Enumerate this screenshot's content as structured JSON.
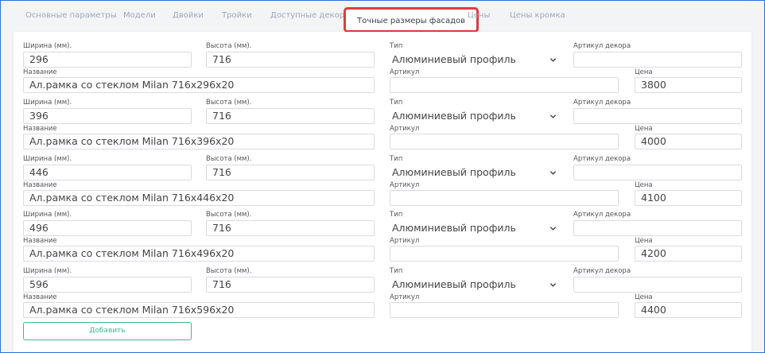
{
  "tabs": [
    {
      "label": "Основные параметры",
      "active": false
    },
    {
      "label": "Модели",
      "active": false
    },
    {
      "label": "Двойки",
      "active": false
    },
    {
      "label": "Тройки",
      "active": false
    },
    {
      "label": "Доступные декоры",
      "active": false
    },
    {
      "label": "Точные размеры фасадов",
      "active": true
    },
    {
      "label": "Цены",
      "active": false
    },
    {
      "label": "Цены кромка",
      "active": false
    }
  ],
  "labels": {
    "width": "Ширина (мм).",
    "height": "Высота (мм).",
    "type": "Тип",
    "decor_article": "Артикул декора",
    "name": "Название",
    "article": "Артикул",
    "price": "Цена"
  },
  "rows": [
    {
      "width": "296",
      "height": "716",
      "type": "Алюминиевый профиль",
      "decor_article": "",
      "name": "Ал.рамка со стеклом Milan 716x296x20",
      "article": "",
      "price": "3800"
    },
    {
      "width": "396",
      "height": "716",
      "type": "Алюминиевый профиль",
      "decor_article": "",
      "name": "Ал.рамка со стеклом Milan 716x396x20",
      "article": "",
      "price": "4000"
    },
    {
      "width": "446",
      "height": "716",
      "type": "Алюминиевый профиль",
      "decor_article": "",
      "name": "Ал.рамка со стеклом Milan 716x446x20",
      "article": "",
      "price": "4100"
    },
    {
      "width": "496",
      "height": "716",
      "type": "Алюминиевый профиль",
      "decor_article": "",
      "name": "Ал.рамка со стеклом Milan 716x496x20",
      "article": "",
      "price": "4200"
    },
    {
      "width": "596",
      "height": "716",
      "type": "Алюминиевый профиль",
      "decor_article": "",
      "name": "Ал.рамка со стеклом Milan 716x596x20",
      "article": "",
      "price": "4400"
    }
  ],
  "add_button": "Добавить",
  "colors": {
    "active_tab_outline": "#e03b3b",
    "add_button": "#3db893",
    "frame": "#2f6fd6"
  }
}
